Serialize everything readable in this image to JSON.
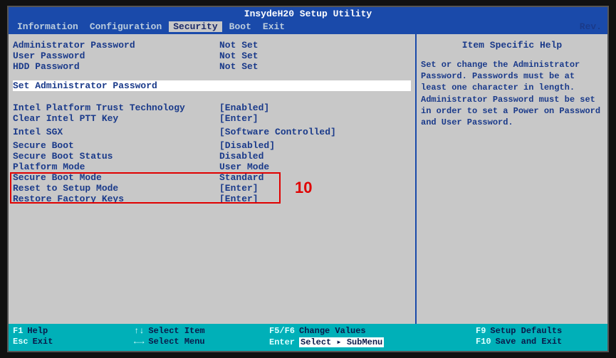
{
  "title": "InsydeH20 Setup Utility",
  "rev": "Rev.",
  "menu": {
    "items": [
      "Information",
      "Configuration",
      "Security",
      "Boot",
      "Exit"
    ],
    "active": "Security"
  },
  "left": {
    "admin_pw": {
      "label": "Administrator Password",
      "value": "Not Set"
    },
    "user_pw": {
      "label": "User Password",
      "value": "Not Set"
    },
    "hdd_pw": {
      "label": "HDD Password",
      "value": "Not Set"
    },
    "set_admin": "Set Administrator Password",
    "iptt": {
      "label": "Intel Platform Trust Technology",
      "value": "[Enabled]"
    },
    "clear_ptt": {
      "label": "Clear Intel PTT Key",
      "value": "[Enter]"
    },
    "sgx": {
      "label": "Intel SGX",
      "value": "[Software Controlled]"
    },
    "secure_boot": {
      "label": "Secure Boot",
      "value": "[Disabled]"
    },
    "secure_boot_status": {
      "label": "Secure Boot Status",
      "value": "Disabled"
    },
    "platform_mode": {
      "label": "Platform Mode",
      "value": "User Mode"
    },
    "secure_boot_mode": {
      "label": "Secure Boot Mode",
      "value": "Standard"
    },
    "reset_setup": {
      "label": "Reset to Setup Mode",
      "value": "[Enter]"
    },
    "restore_keys": {
      "label": "Restore Factory Keys",
      "value": "[Enter]"
    }
  },
  "help": {
    "title": "Item Specific Help",
    "body": "Set or change the Administrator Password. Passwords must be at least one character in length.\nAdministrator Password must be set in order to set a Power on Password and User Password."
  },
  "footer": {
    "f1": "Help",
    "esc": "Exit",
    "updn": "Select Item",
    "lr": "Select Menu",
    "f5f6": "Change Values",
    "enter": "Select ▸ SubMenu",
    "f9": "Setup Defaults",
    "f10": "Save and Exit"
  },
  "annotation": {
    "number": "10"
  }
}
